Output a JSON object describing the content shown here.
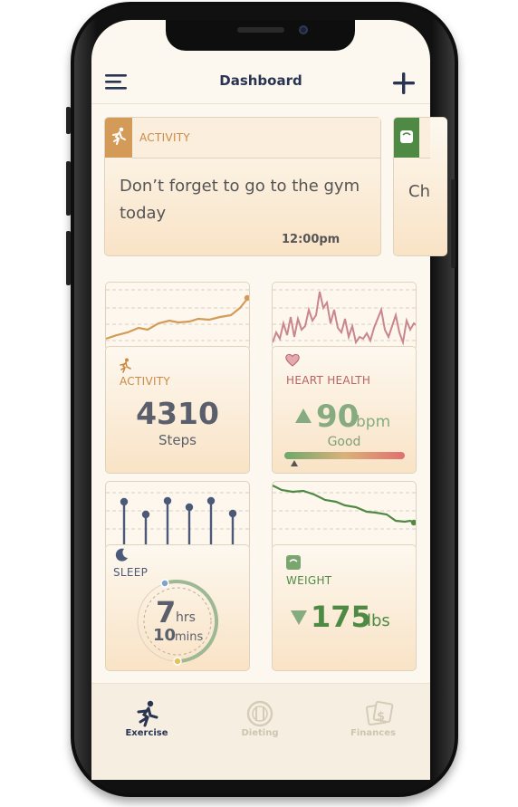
{
  "header": {
    "title": "Dashboard"
  },
  "reminder_card": {
    "category": "ACTIVITY",
    "message_line1": "Don’t forget to go to the gym",
    "message_line2": "today",
    "time": "12:00pm"
  },
  "next_card": {
    "text_fragment": "Ch"
  },
  "activity": {
    "label": "ACTIVITY",
    "value": "4310",
    "unit": "Steps"
  },
  "heart": {
    "label": "HEART HEALTH",
    "value": "90",
    "unit": "bpm",
    "status": "Good"
  },
  "sleep": {
    "label": "SLEEP",
    "hours": "7",
    "hours_unit": "hrs",
    "minutes": "10",
    "minutes_unit": "mins"
  },
  "weight": {
    "label": "WEIGHT",
    "value": "175",
    "unit": "lbs"
  },
  "tabs": [
    {
      "label": "Exercise",
      "icon": "runner-icon"
    },
    {
      "label": "Dieting",
      "icon": "plate-icon"
    },
    {
      "label": "Finances",
      "icon": "money-icon"
    }
  ],
  "colors": {
    "orange": "#c98a45",
    "rose": "#b5626a",
    "slate": "#4a5a78",
    "green": "#4f8a44",
    "navy": "#283452"
  }
}
